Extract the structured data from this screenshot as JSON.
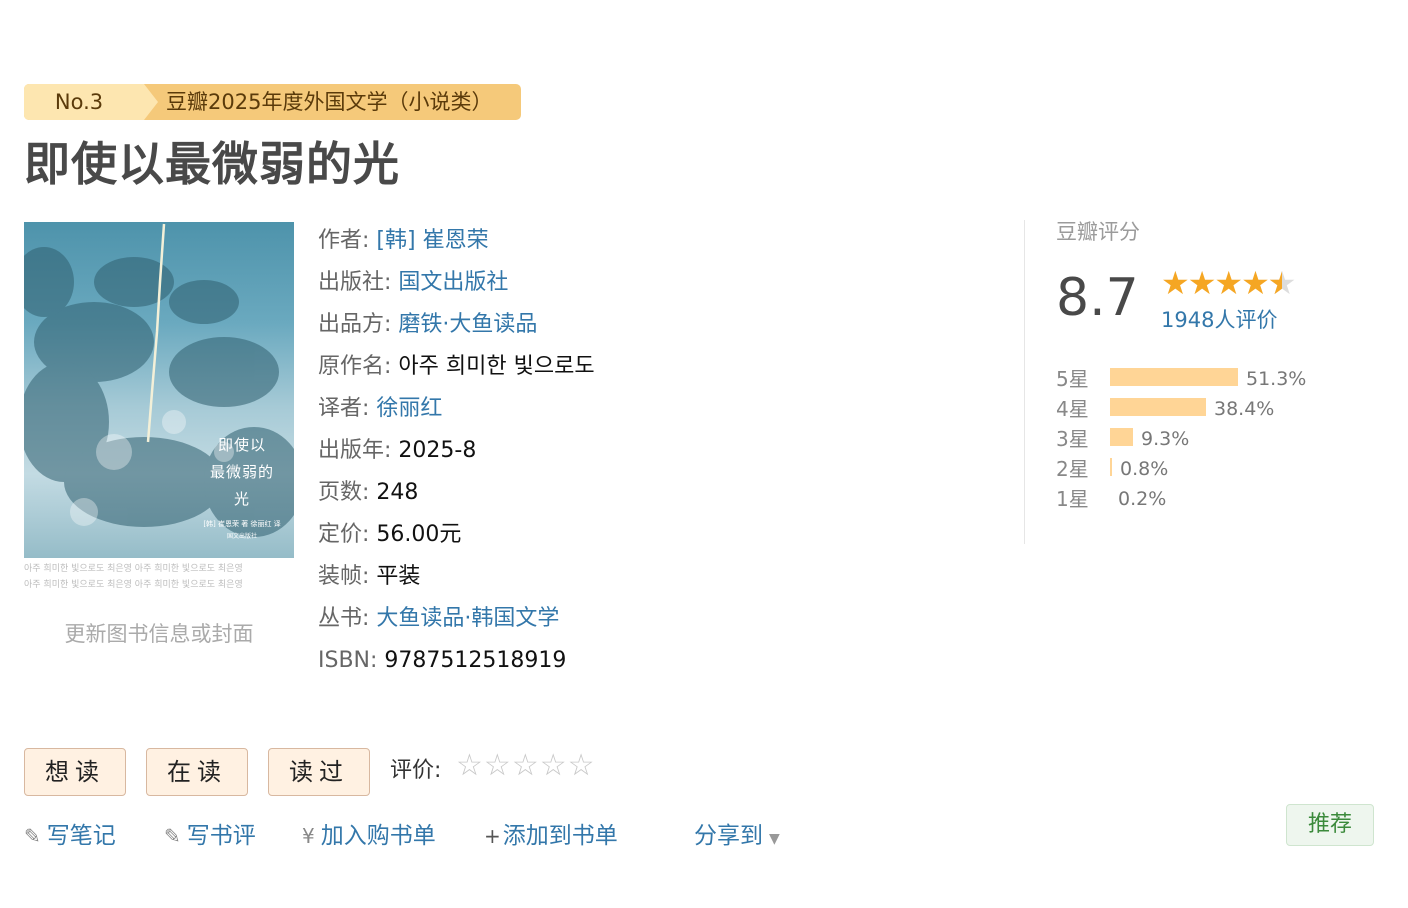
{
  "badge": {
    "rank": "No.3",
    "text": "豆瓣2025年度外国文学（小说类）"
  },
  "title": "即使以最微弱的光",
  "cover": {
    "title_line1": "即使以",
    "title_line2": "最微弱的",
    "title_line3": "光",
    "meta": "[韩] 崔恩荣 著   徐丽红 译",
    "publisher_mark": "国文出版社",
    "strip_line1": "아주 희미한 빛으로도  최은영   아주 희미한 빛으로도  최은영",
    "strip_line2": "아주 희미한 빛으로도  최은영   아주 희미한 빛으로도  최은영",
    "update_link": "更新图书信息或封面"
  },
  "info": {
    "author_label": "作者:",
    "author": "[韩] 崔恩荣",
    "publisher_label": "出版社:",
    "publisher": "国文出版社",
    "producer_label": "出品方:",
    "producer": "磨铁·大鱼读品",
    "original_label": "原作名:",
    "original": "아주 희미한 빛으로도",
    "translator_label": "译者:",
    "translator": "徐丽红",
    "year_label": "出版年:",
    "year": "2025-8",
    "pages_label": "页数:",
    "pages": "248",
    "price_label": "定价:",
    "price": "56.00元",
    "binding_label": "装帧:",
    "binding": "平装",
    "series_label": "丛书:",
    "series": "大鱼读品·韩国文学",
    "isbn_label": "ISBN:",
    "isbn": "9787512518919"
  },
  "rating": {
    "label": "豆瓣评分",
    "score": "8.7",
    "stars": 4.5,
    "count": "1948人评价",
    "distribution": [
      {
        "label": "5星",
        "pct": "51.3%",
        "value": 51.3
      },
      {
        "label": "4星",
        "pct": "38.4%",
        "value": 38.4
      },
      {
        "label": "3星",
        "pct": "9.3%",
        "value": 9.3
      },
      {
        "label": "2星",
        "pct": "0.8%",
        "value": 0.8
      },
      {
        "label": "1星",
        "pct": "0.2%",
        "value": 0.2
      }
    ]
  },
  "actions": {
    "want": "想读",
    "reading": "在读",
    "read": "读过",
    "rate_label": "评价:",
    "write_note": "写笔记",
    "write_review": "写书评",
    "add_cart": "加入购书单",
    "add_list": "添加到书单",
    "share": "分享到",
    "recommend": "推荐"
  },
  "colors": {
    "link": "#3377aa",
    "star": "#f5a623",
    "bar": "#ffd596",
    "badge": "#f5c97a"
  }
}
